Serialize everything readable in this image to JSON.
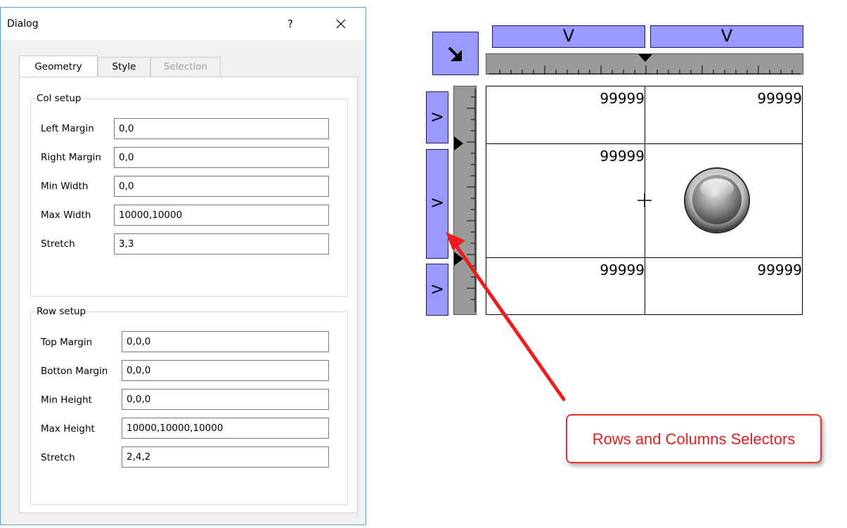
{
  "dialog": {
    "title": "Dialog",
    "help": "?",
    "tabs": [
      {
        "label": "Geometry",
        "state": "active"
      },
      {
        "label": "Style",
        "state": "normal"
      },
      {
        "label": "Selection",
        "state": "disabled"
      }
    ],
    "col_setup": {
      "title": "Col setup",
      "fields": [
        {
          "label": "Left Margin",
          "value": "0,0"
        },
        {
          "label": "Right Margin",
          "value": "0,0"
        },
        {
          "label": "Min Width",
          "value": "0,0"
        },
        {
          "label": "Max Width",
          "value": "10000,10000"
        },
        {
          "label": "Stretch",
          "value": "3,3"
        }
      ]
    },
    "row_setup": {
      "title": "Row setup",
      "fields": [
        {
          "label": "Top Margin",
          "value": "0,0,0"
        },
        {
          "label": "Botton Margin",
          "value": "0,0,0"
        },
        {
          "label": "Min Height",
          "value": "0,0,0"
        },
        {
          "label": "Max Height",
          "value": "10000,10000,10000"
        },
        {
          "label": "Stretch",
          "value": "2,4,2"
        }
      ]
    }
  },
  "editor": {
    "col_selector_glyph": "V",
    "row_selector_glyph": ">",
    "cells": [
      "99999",
      "99999",
      "99999",
      "99999",
      "99999"
    ],
    "selector_color": "#9999ff",
    "ruler_color": "#9a9a9a"
  },
  "callout": {
    "text": "Rows and Columns Selectors",
    "color": "#e02020"
  }
}
